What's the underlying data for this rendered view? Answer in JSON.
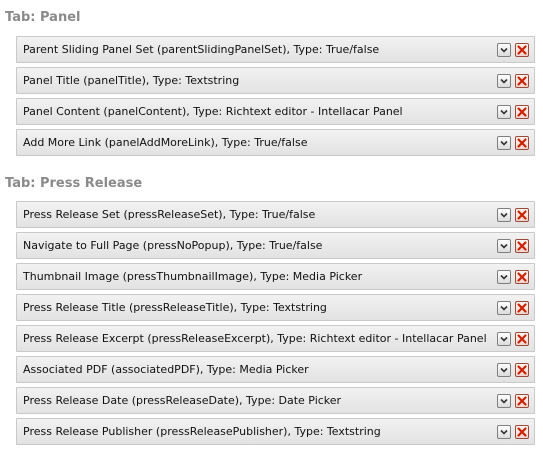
{
  "tabs": [
    {
      "heading": "Tab: Panel",
      "properties": [
        {
          "label": "Parent Sliding Panel Set (parentSlidingPanelSet), Type: True/false"
        },
        {
          "label": "Panel Title (panelTitle), Type: Textstring"
        },
        {
          "label": "Panel Content (panelContent), Type: Richtext editor - Intellacar Panel"
        },
        {
          "label": "Add More Link (panelAddMoreLink), Type: True/false"
        }
      ]
    },
    {
      "heading": "Tab: Press Release",
      "properties": [
        {
          "label": "Press Release Set (pressReleaseSet), Type: True/false"
        },
        {
          "label": "Navigate to Full Page (pressNoPopup), Type: True/false"
        },
        {
          "label": "Thumbnail Image (pressThumbnailImage), Type: Media Picker"
        },
        {
          "label": "Press Release Title (pressReleaseTitle), Type: Textstring"
        },
        {
          "label": "Press Release Excerpt (pressReleaseExcerpt), Type: Richtext editor - Intellacar Panel"
        },
        {
          "label": "Associated PDF (associatedPDF), Type: Media Picker"
        },
        {
          "label": "Press Release Date (pressReleaseDate), Type: Date Picker"
        },
        {
          "label": "Press Release Publisher (pressReleasePublisher), Type: Textstring"
        }
      ]
    }
  ],
  "icons": {
    "expand": "chevron-down-icon",
    "delete": "delete-x-icon"
  },
  "colors": {
    "heading": "#8a8a8a",
    "delete": "#cc2200",
    "expand": "#333333"
  }
}
